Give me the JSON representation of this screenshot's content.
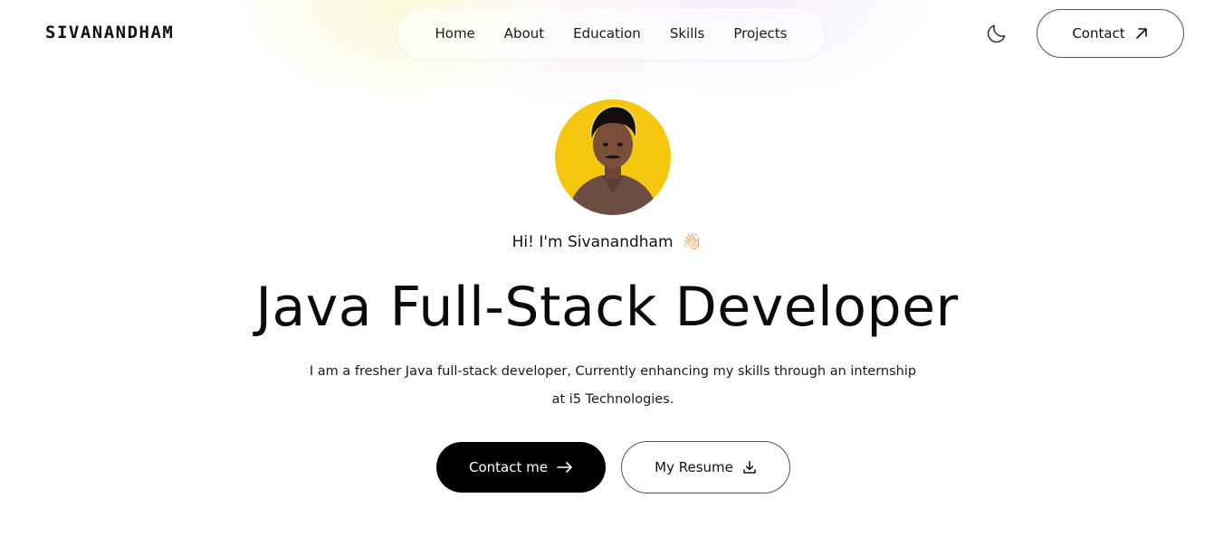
{
  "brand": {
    "logo_text": "SIVANANDHAM"
  },
  "nav": {
    "items": [
      {
        "label": "Home"
      },
      {
        "label": "About"
      },
      {
        "label": "Education"
      },
      {
        "label": "Skills"
      },
      {
        "label": "Projects"
      }
    ]
  },
  "header": {
    "theme_toggle_icon": "moon-icon",
    "contact_label": "Contact",
    "contact_icon": "arrow-up-right-icon"
  },
  "hero": {
    "avatar_bg_color": "#f5c60f",
    "greeting": "Hi! I'm Sivanandham",
    "greeting_emoji": "👋🏻",
    "headline": "Java Full-Stack Developer",
    "description": "I am a fresher Java full-stack developer, Currently enhancing my skills through an internship at i5 Technologies.",
    "primary_button": {
      "label": "Contact me",
      "icon": "arrow-right-icon"
    },
    "secondary_button": {
      "label": "My Resume",
      "icon": "download-icon"
    }
  }
}
